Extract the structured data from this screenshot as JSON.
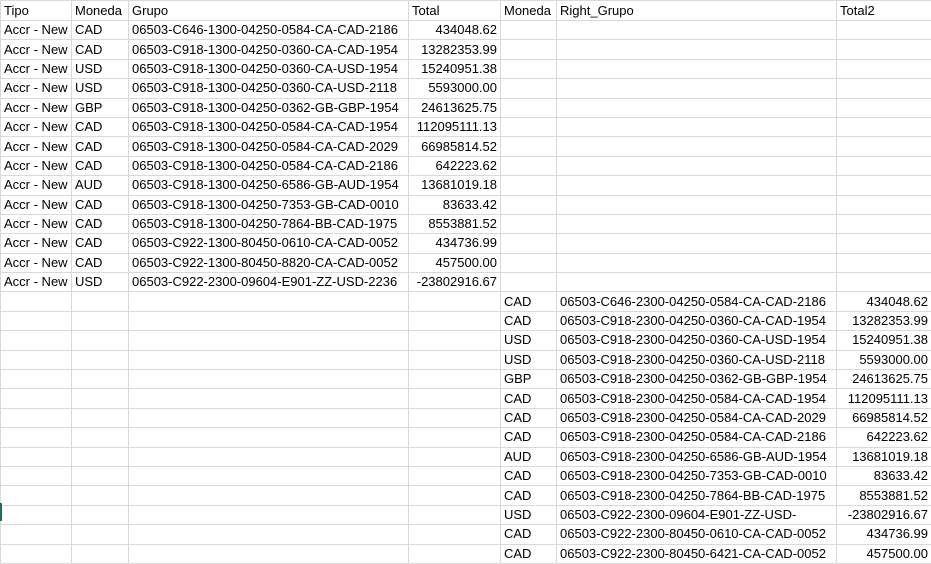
{
  "headers": [
    "Tipo",
    "Moneda",
    "Grupo",
    "Total",
    "Moneda",
    "Right_Grupo",
    "Total2"
  ],
  "left_rows": [
    [
      "Accr - New",
      "CAD",
      "06503-C646-1300-04250-0584-CA-CAD-2186",
      "434048.62"
    ],
    [
      "Accr - New",
      "CAD",
      "06503-C918-1300-04250-0360-CA-CAD-1954",
      "13282353.99"
    ],
    [
      "Accr - New",
      "USD",
      "06503-C918-1300-04250-0360-CA-USD-1954",
      "15240951.38"
    ],
    [
      "Accr - New",
      "USD",
      "06503-C918-1300-04250-0360-CA-USD-2118",
      "5593000.00"
    ],
    [
      "Accr - New",
      "GBP",
      "06503-C918-1300-04250-0362-GB-GBP-1954",
      "24613625.75"
    ],
    [
      "Accr - New",
      "CAD",
      "06503-C918-1300-04250-0584-CA-CAD-1954",
      "112095111.13"
    ],
    [
      "Accr - New",
      "CAD",
      "06503-C918-1300-04250-0584-CA-CAD-2029",
      "66985814.52"
    ],
    [
      "Accr - New",
      "CAD",
      "06503-C918-1300-04250-0584-CA-CAD-2186",
      "642223.62"
    ],
    [
      "Accr - New",
      "AUD",
      "06503-C918-1300-04250-6586-GB-AUD-1954",
      "13681019.18"
    ],
    [
      "Accr - New",
      "CAD",
      "06503-C918-1300-04250-7353-GB-CAD-0010",
      "83633.42"
    ],
    [
      "Accr - New",
      "CAD",
      "06503-C918-1300-04250-7864-BB-CAD-1975",
      "8553881.52"
    ],
    [
      "Accr - New",
      "CAD",
      "06503-C922-1300-80450-0610-CA-CAD-0052",
      "434736.99"
    ],
    [
      "Accr - New",
      "CAD",
      "06503-C922-1300-80450-8820-CA-CAD-0052",
      "457500.00"
    ],
    [
      "Accr - New",
      "USD",
      "06503-C922-2300-09604-E901-ZZ-USD-2236",
      "-23802916.67"
    ]
  ],
  "right_rows": [
    [
      "CAD",
      "06503-C646-2300-04250-0584-CA-CAD-2186",
      "434048.62"
    ],
    [
      "CAD",
      "06503-C918-2300-04250-0360-CA-CAD-1954",
      "13282353.99"
    ],
    [
      "USD",
      "06503-C918-2300-04250-0360-CA-USD-1954",
      "15240951.38"
    ],
    [
      "USD",
      "06503-C918-2300-04250-0360-CA-USD-2118",
      "5593000.00"
    ],
    [
      "GBP",
      "06503-C918-2300-04250-0362-GB-GBP-1954",
      "24613625.75"
    ],
    [
      "CAD",
      "06503-C918-2300-04250-0584-CA-CAD-1954",
      "112095111.13"
    ],
    [
      "CAD",
      "06503-C918-2300-04250-0584-CA-CAD-2029",
      "66985814.52"
    ],
    [
      "CAD",
      "06503-C918-2300-04250-0584-CA-CAD-2186",
      "642223.62"
    ],
    [
      "AUD",
      "06503-C918-2300-04250-6586-GB-AUD-1954",
      "13681019.18"
    ],
    [
      "CAD",
      "06503-C918-2300-04250-7353-GB-CAD-0010",
      "83633.42"
    ],
    [
      "CAD",
      "06503-C918-2300-04250-7864-BB-CAD-1975",
      "8553881.52"
    ],
    [
      "USD",
      "06503-C922-2300-09604-E901-ZZ-USD-",
      "-23802916.67"
    ],
    [
      "CAD",
      "06503-C922-2300-80450-0610-CA-CAD-0052",
      "434736.99"
    ],
    [
      "CAD",
      "06503-C922-2300-80450-6421-CA-CAD-0052",
      "457500.00"
    ]
  ]
}
